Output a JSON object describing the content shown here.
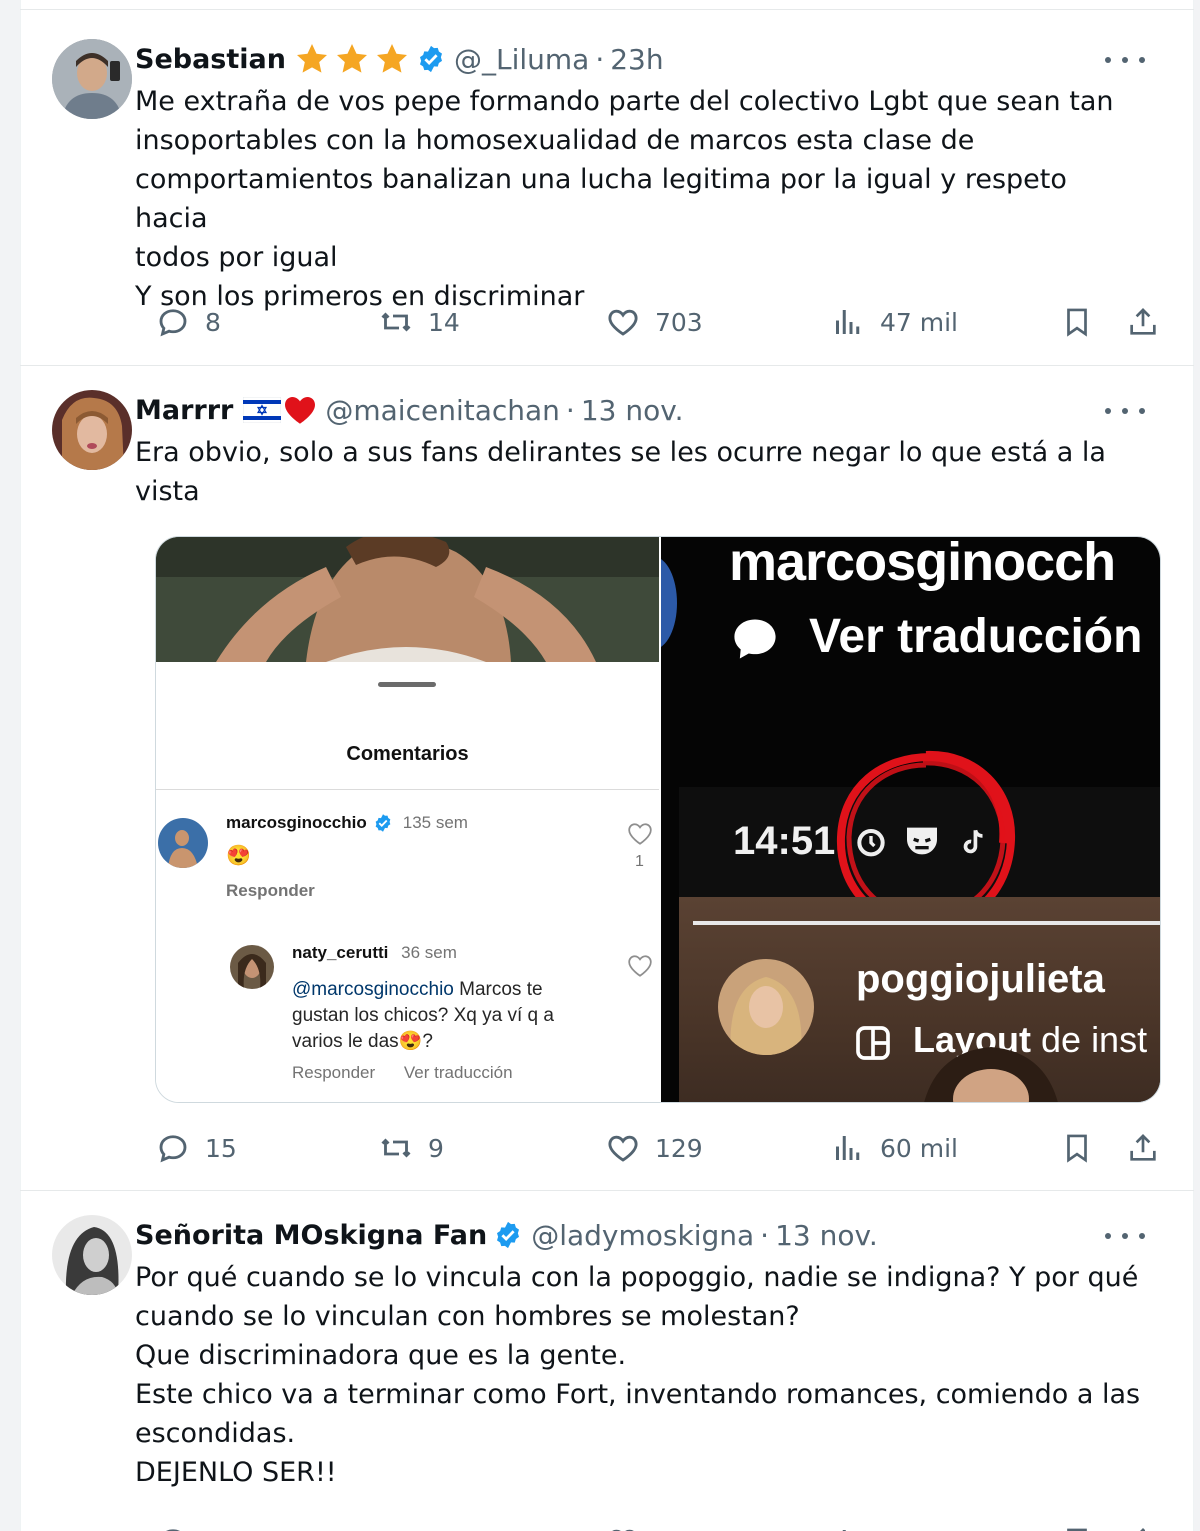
{
  "tweets": [
    {
      "name": "Sebastian",
      "handle": "@_Liluma",
      "time": "23h",
      "text": [
        "Me extraña de vos pepe formando parte del colectivo Lgbt  que sean tan",
        "insoportables con la homosexualidad de marcos esta clase de",
        "comportamientos banalizan una lucha legitima por la igual y respeto hacia",
        "todos por igual",
        "Y son los primeros en discriminar"
      ],
      "replies": "8",
      "reposts": "14",
      "likes": "703",
      "views": "47 mil"
    },
    {
      "name": "Marrrr",
      "handle": "@maicenitachan",
      "time": "13 nov.",
      "text": [
        "Era obvio, solo a sus fans delirantes se les ocurre negar lo que está a la",
        "vista"
      ],
      "replies": "15",
      "reposts": "9",
      "likes": "129",
      "views": "60 mil"
    },
    {
      "name": "Señorita MOskigna Fan",
      "handle": "@ladymoskigna",
      "time": "13 nov.",
      "text": [
        "Por qué cuando se lo vincula con la popoggio, nadie se indigna? Y por qué",
        "cuando se lo vinculan con hombres se molestan?",
        "Que discriminadora que es la gente.",
        "Este chico va a terminar como Fort, inventando romances, comiendo a las",
        "escondidas.",
        "DEJENLO SER!!"
      ]
    }
  ],
  "media": {
    "left": {
      "sheet_title": "Comentarios",
      "comment1": {
        "user": "marcosginocchio",
        "age": "135 sem",
        "emoji": "😍",
        "reply": "Responder",
        "like_count": "1"
      },
      "comment2": {
        "user": "naty_cerutti",
        "age": "36 sem",
        "mention": "@marcosginocchio",
        "text_a": " Marcos te",
        "text_b": "gustan los chicos? Xq ya ví q a",
        "text_c": "varios le das😍?",
        "reply": "Responder",
        "translate": "Ver traducción"
      }
    },
    "right": {
      "username": "marcosginocch",
      "translate": "Ver traducción",
      "clock": "14:51",
      "story_user": "poggiojulieta",
      "layout_bold": "Layout",
      "layout_rest": " de inst"
    }
  },
  "colors": {
    "verified": "#1d9bf0",
    "secondary_text": "#536471",
    "star": "#f5a623",
    "highlight_circle": "#e0121a"
  },
  "icons": [
    "reply-icon",
    "repost-icon",
    "like-icon",
    "views-icon",
    "bookmark-icon",
    "share-icon",
    "verified-icon",
    "more-icon",
    "star-icon"
  ]
}
